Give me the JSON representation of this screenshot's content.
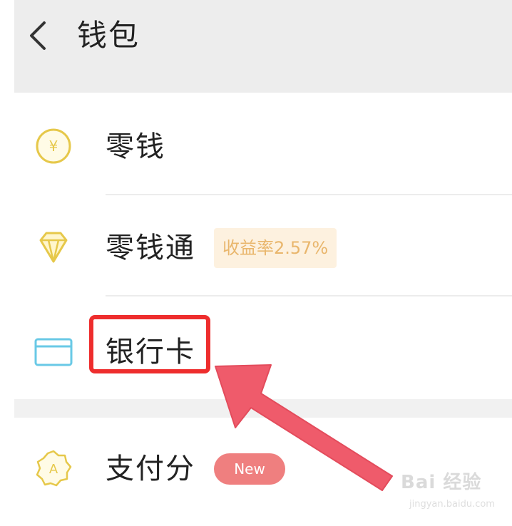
{
  "header": {
    "title": "钱包",
    "back_icon": "chevron-left-icon"
  },
  "menu": {
    "items": [
      {
        "label": "零钱",
        "icon": "yuan-coin-icon"
      },
      {
        "label": "零钱通",
        "icon": "diamond-icon",
        "badge": "收益率2.57%"
      },
      {
        "label": "银行卡",
        "icon": "bank-card-icon",
        "highlighted": true
      },
      {
        "label": "支付分",
        "icon": "badge-a-icon",
        "badge": "New"
      }
    ]
  },
  "annotation": {
    "box_color": "#ee2d2d",
    "arrow_color": "#ef5b6b"
  },
  "watermark": {
    "logo": "Bai 经验",
    "url": "jingyan.baidu.com"
  },
  "colors": {
    "icon_gold": "#e6c84a",
    "icon_card": "#69c9e6",
    "rate_badge_bg": "#fdf1df",
    "rate_badge_text": "#e9b66c",
    "new_badge_bg": "#ef7f7f"
  }
}
